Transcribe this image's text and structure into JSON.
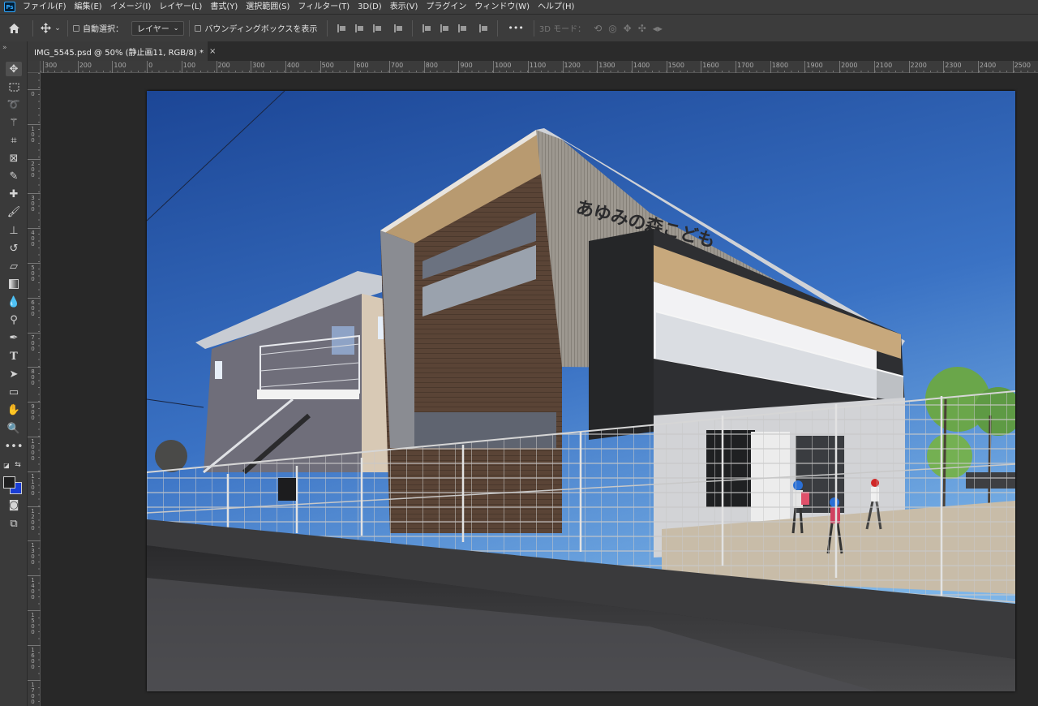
{
  "app": {
    "logo_text": "Ps"
  },
  "menu": {
    "items": [
      "ファイル(F)",
      "編集(E)",
      "イメージ(I)",
      "レイヤー(L)",
      "書式(Y)",
      "選択範囲(S)",
      "フィルター(T)",
      "3D(D)",
      "表示(V)",
      "プラグイン",
      "ウィンドウ(W)",
      "ヘルプ(H)"
    ]
  },
  "options": {
    "auto_select_label": "自動選択：",
    "auto_select_target": "レイヤー",
    "bounding_box_label": "バウンディングボックスを表示",
    "more_label": "•••",
    "mode_3d_label": "3D モード："
  },
  "document": {
    "tab_title": "IMG_5545.psd @ 50% (静止画11, RGB/8) *",
    "close_glyph": "×",
    "zoom": "50%",
    "color_mode": "RGB/8",
    "layer": "静止画11"
  },
  "ruler": {
    "top_labels": [
      "300",
      "200",
      "100",
      "0",
      "100",
      "200",
      "300",
      "400",
      "500",
      "600",
      "700",
      "800",
      "900",
      "1000",
      "1100",
      "1200",
      "1300",
      "1400",
      "1500",
      "1600",
      "1700",
      "1800",
      "1900",
      "2000",
      "2100",
      "2200",
      "2300",
      "2400",
      "2500"
    ],
    "left_labels": [
      "0",
      "100",
      "200",
      "300",
      "400",
      "500",
      "600",
      "700",
      "800",
      "900",
      "1000",
      "1100",
      "1200",
      "1300",
      "1400",
      "1500",
      "1600",
      "1700"
    ]
  },
  "image": {
    "sign_text": "あゆみの森こども"
  },
  "colors": {
    "foreground": "#1f1f1f",
    "background": "#1a3ed6",
    "sky_top": "#1e4a9a",
    "sky_bottom": "#5e9ee0"
  },
  "tools": [
    "move-tool",
    "marquee-tool",
    "lasso-tool",
    "magic-wand-tool",
    "crop-tool",
    "frame-tool",
    "eyedropper-tool",
    "healing-brush-tool",
    "brush-tool",
    "clone-stamp-tool",
    "history-brush-tool",
    "eraser-tool",
    "gradient-tool",
    "blur-tool",
    "dodge-tool",
    "pen-tool",
    "type-tool",
    "path-selection-tool",
    "rectangle-tool",
    "hand-tool",
    "zoom-tool",
    "edit-toolbar"
  ]
}
